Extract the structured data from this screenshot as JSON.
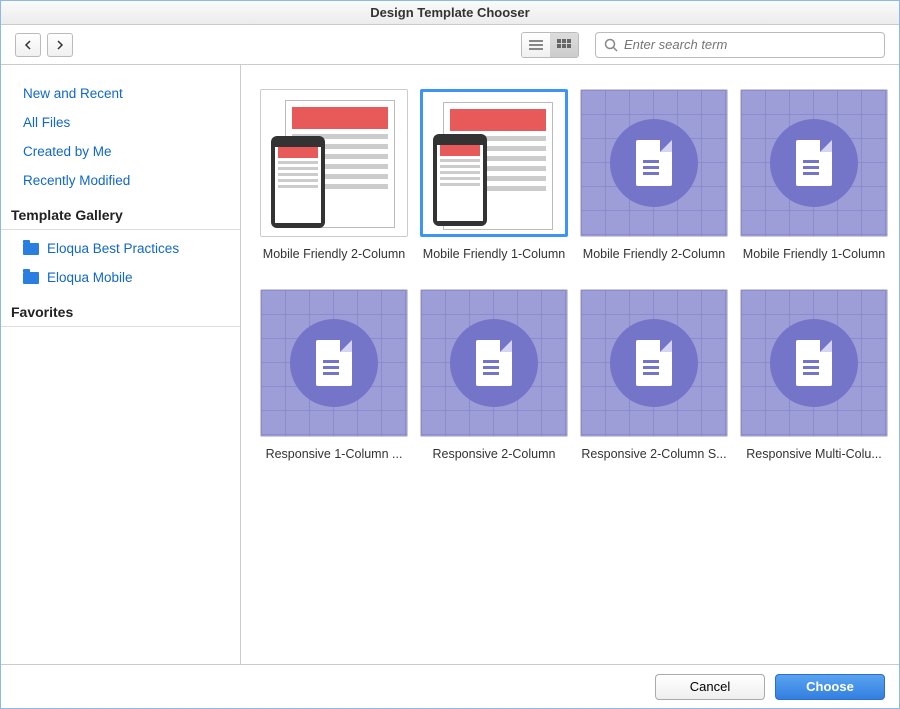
{
  "title": "Design Template Chooser",
  "search": {
    "placeholder": "Enter search term"
  },
  "sidebar": {
    "links": [
      {
        "label": "New and Recent"
      },
      {
        "label": "All Files"
      },
      {
        "label": "Created by Me"
      },
      {
        "label": "Recently Modified"
      }
    ],
    "sections": [
      {
        "title": "Template Gallery",
        "items": [
          {
            "label": "Eloqua Best Practices"
          },
          {
            "label": "Eloqua Mobile"
          }
        ]
      },
      {
        "title": "Favorites",
        "items": []
      }
    ]
  },
  "templates": [
    {
      "label": "Mobile Friendly 2-Column",
      "kind": "mock",
      "selected": false
    },
    {
      "label": "Mobile Friendly 1-Column",
      "kind": "mock",
      "selected": true
    },
    {
      "label": "Mobile Friendly 2-Column",
      "kind": "purple",
      "selected": false
    },
    {
      "label": "Mobile Friendly 1-Column",
      "kind": "purple",
      "selected": false
    },
    {
      "label": "Responsive 1-Column ...",
      "kind": "purple",
      "selected": false
    },
    {
      "label": "Responsive 2-Column",
      "kind": "purple",
      "selected": false
    },
    {
      "label": "Responsive 2-Column S...",
      "kind": "purple",
      "selected": false
    },
    {
      "label": "Responsive Multi-Colu...",
      "kind": "purple",
      "selected": false
    }
  ],
  "footer": {
    "cancel": "Cancel",
    "choose": "Choose"
  }
}
